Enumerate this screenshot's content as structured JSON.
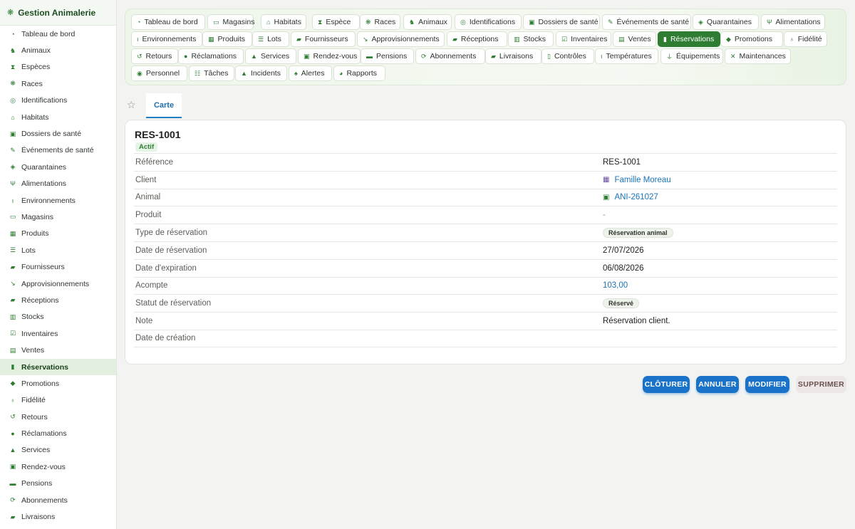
{
  "app": {
    "title": "Gestion Animalerie"
  },
  "sidebar": {
    "items": [
      {
        "label": "Tableau de bord",
        "icon": "gauge-icon"
      },
      {
        "label": "Animaux",
        "icon": "dog-icon"
      },
      {
        "label": "Espèces",
        "icon": "dna-icon"
      },
      {
        "label": "Races",
        "icon": "paw-icon"
      },
      {
        "label": "Identifications",
        "icon": "fingerprint-icon"
      },
      {
        "label": "Habitats",
        "icon": "house-icon"
      },
      {
        "label": "Dossiers de santé",
        "icon": "file-medical-icon"
      },
      {
        "label": "Événements de santé",
        "icon": "syringe-icon"
      },
      {
        "label": "Quarantaines",
        "icon": "shield-icon"
      },
      {
        "label": "Alimentations",
        "icon": "utensils-icon"
      },
      {
        "label": "Environnements",
        "icon": "thermometer-icon"
      },
      {
        "label": "Magasins",
        "icon": "store-icon"
      },
      {
        "label": "Produits",
        "icon": "box-icon"
      },
      {
        "label": "Lots",
        "icon": "list-icon"
      },
      {
        "label": "Fournisseurs",
        "icon": "truck-icon"
      },
      {
        "label": "Approvisionnements",
        "icon": "dolly-icon"
      },
      {
        "label": "Réceptions",
        "icon": "truck-loading-icon"
      },
      {
        "label": "Stocks",
        "icon": "warehouse-icon"
      },
      {
        "label": "Inventaires",
        "icon": "clipboard-check-icon"
      },
      {
        "label": "Ventes",
        "icon": "cash-register-icon"
      },
      {
        "label": "Réservations",
        "icon": "bookmark-icon",
        "active": true
      },
      {
        "label": "Promotions",
        "icon": "tags-icon"
      },
      {
        "label": "Fidélité",
        "icon": "award-icon"
      },
      {
        "label": "Retours",
        "icon": "undo-icon"
      },
      {
        "label": "Réclamations",
        "icon": "comment-icon"
      },
      {
        "label": "Services",
        "icon": "bell-concierge-icon"
      },
      {
        "label": "Rendez-vous",
        "icon": "calendar-check-icon"
      },
      {
        "label": "Pensions",
        "icon": "bed-icon"
      },
      {
        "label": "Abonnements",
        "icon": "sync-icon"
      },
      {
        "label": "Livraisons",
        "icon": "shipping-fast-icon"
      }
    ]
  },
  "tabs": [
    {
      "label": "Tableau de bord",
      "icon": "gauge-icon"
    },
    {
      "label": "Magasins",
      "icon": "store-icon"
    },
    {
      "label": "Habitats",
      "icon": "house-icon"
    },
    {
      "label": "Espèce",
      "icon": "dna-icon"
    },
    {
      "label": "Races",
      "icon": "paw-icon"
    },
    {
      "label": "Animaux",
      "icon": "dog-icon"
    },
    {
      "label": "Identifications",
      "icon": "fingerprint-icon"
    },
    {
      "label": "Dossiers de santé",
      "icon": "file-medical-icon"
    },
    {
      "label": "Événements de santé",
      "icon": "syringe-icon"
    },
    {
      "label": "Quarantaines",
      "icon": "shield-icon"
    },
    {
      "label": "Alimentations",
      "icon": "utensils-icon"
    },
    {
      "label": "Environnements",
      "icon": "thermometer-icon"
    },
    {
      "label": "Produits",
      "icon": "box-icon"
    },
    {
      "label": "Lots",
      "icon": "list-icon"
    },
    {
      "label": "Fournisseurs",
      "icon": "truck-icon"
    },
    {
      "label": "Approvisionnements",
      "icon": "dolly-icon"
    },
    {
      "label": "Réceptions",
      "icon": "truck-loading-icon"
    },
    {
      "label": "Stocks",
      "icon": "warehouse-icon"
    },
    {
      "label": "Inventaires",
      "icon": "clipboard-check-icon"
    },
    {
      "label": "Ventes",
      "icon": "cash-register-icon"
    },
    {
      "label": "Réservations",
      "icon": "bookmark-icon",
      "active": true
    },
    {
      "label": "Promotions",
      "icon": "tags-icon"
    },
    {
      "label": "Fidélité",
      "icon": "award-icon"
    },
    {
      "label": "Retours",
      "icon": "undo-icon"
    },
    {
      "label": "Réclamations",
      "icon": "comment-icon"
    },
    {
      "label": "Services",
      "icon": "bell-concierge-icon"
    },
    {
      "label": "Rendez-vous",
      "icon": "calendar-check-icon"
    },
    {
      "label": "Pensions",
      "icon": "bed-icon"
    },
    {
      "label": "Abonnements",
      "icon": "sync-icon"
    },
    {
      "label": "Livraisons",
      "icon": "shipping-fast-icon"
    },
    {
      "label": "Contrôles",
      "icon": "clipboard-icon"
    },
    {
      "label": "Températures",
      "icon": "thermometer-icon"
    },
    {
      "label": "Équipements",
      "icon": "plug-icon"
    },
    {
      "label": "Maintenances",
      "icon": "tools-icon"
    },
    {
      "label": "Personnel",
      "icon": "users-icon"
    },
    {
      "label": "Tâches",
      "icon": "tasks-icon"
    },
    {
      "label": "Incidents",
      "icon": "warning-icon"
    },
    {
      "label": "Alertes",
      "icon": "bell-icon"
    },
    {
      "label": "Rapports",
      "icon": "chart-pie-icon"
    }
  ],
  "subtabs": {
    "active_label": "Carte"
  },
  "record": {
    "title": "RES-1001",
    "status": "Actif",
    "fields": [
      {
        "label": "Référence",
        "value": "RES-1001",
        "kind": "text"
      },
      {
        "label": "Client",
        "value": "Famille Moreau",
        "kind": "link",
        "icon": "building-icon"
      },
      {
        "label": "Animal",
        "value": "ANI-261027",
        "kind": "link",
        "icon": "animal-icon"
      },
      {
        "label": "Produit",
        "value": "-",
        "kind": "muted"
      },
      {
        "label": "Type de réservation",
        "value": "Réservation animal",
        "kind": "pill"
      },
      {
        "label": "Date de réservation",
        "value": "27/07/2026",
        "kind": "text"
      },
      {
        "label": "Date d'expiration",
        "value": "06/08/2026",
        "kind": "text"
      },
      {
        "label": "Acompte",
        "value": "103,00",
        "kind": "num"
      },
      {
        "label": "Statut de réservation",
        "value": "Réservé",
        "kind": "pill"
      },
      {
        "label": "Note",
        "value": "Réservation client.",
        "kind": "text"
      },
      {
        "label": "Date de création",
        "value": "",
        "kind": "text"
      }
    ]
  },
  "actions": {
    "close_label": "CLÔTURER",
    "cancel_label": "ANNULER",
    "edit_label": "MODIFIER",
    "delete_label": "SUPPRIMER"
  },
  "colors": {
    "accent": "#2e7d32",
    "primary_button": "#1a73c8",
    "link": "#1a73b8"
  }
}
